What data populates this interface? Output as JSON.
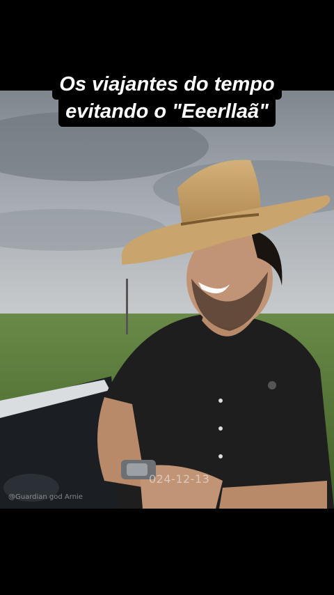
{
  "caption": {
    "line1": "Os viajantes do tempo",
    "line2": "evitando o \"Eeerllaã\""
  },
  "overlay": {
    "date_stamp": "024-12-13",
    "watermark": "@Guardian god Arnie"
  },
  "colors": {
    "background": "#000000",
    "caption_bg": "#000000",
    "caption_text": "#ffffff",
    "hat": "#c9a46c",
    "shirt": "#1e1e1e",
    "sky": "#9aa1a8",
    "field": "#5a7a3a"
  }
}
